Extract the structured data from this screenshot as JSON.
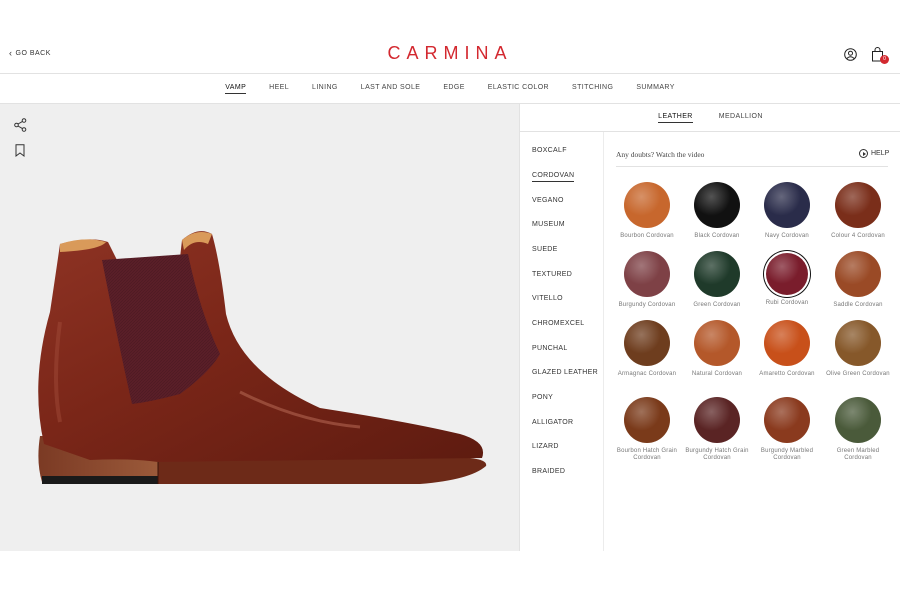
{
  "header": {
    "go_back": "GO BACK",
    "logo": "CARMINA",
    "cart_count": "0"
  },
  "nav": {
    "tabs": [
      "VAMP",
      "HEEL",
      "LINING",
      "LAST AND SOLE",
      "EDGE",
      "ELASTIC COLOR",
      "STITCHING",
      "SUMMARY"
    ],
    "active": "VAMP"
  },
  "panel": {
    "subtabs": [
      "LEATHER",
      "MEDALLION"
    ],
    "active_subtab": "LEATHER",
    "materials": [
      "BOXCALF",
      "CORDOVAN",
      "VEGANO",
      "MUSEUM",
      "SUEDE",
      "TEXTURED",
      "VITELLO",
      "CHROMEXCEL",
      "PUNCHAL",
      "GLAZED LEATHER",
      "PONY",
      "ALLIGATOR",
      "LIZARD",
      "BRAIDED"
    ],
    "active_material": "CORDOVAN",
    "doubts_text": "Any doubts? Watch the video",
    "help_label": "HELP",
    "swatches": [
      {
        "label": "Bourbon Cordovan",
        "color": "#c7672d"
      },
      {
        "label": "Black Cordovan",
        "color": "#111111"
      },
      {
        "label": "Navy Cordovan",
        "color": "#2a2c4a"
      },
      {
        "label": "Colour 4 Cordovan",
        "color": "#7a2e1a"
      },
      {
        "label": "Burgundy Cordovan",
        "color": "#7e4146"
      },
      {
        "label": "Green Cordovan",
        "color": "#1f3a2a"
      },
      {
        "label": "Rubi Cordovan",
        "color": "#7a1d2c"
      },
      {
        "label": "Saddle Cordovan",
        "color": "#9a4a26"
      },
      {
        "label": "Armagnac Cordovan",
        "color": "#6e3d1e"
      },
      {
        "label": "Natural Cordovan",
        "color": "#b4582a"
      },
      {
        "label": "Amaretto Cordovan",
        "color": "#c8501a"
      },
      {
        "label": "Olive Green Cordovan",
        "color": "#86582a"
      },
      {
        "label": "Bourbon Hatch Grain Cordovan",
        "color": "#7a3a1a"
      },
      {
        "label": "Burgundy Hatch Grain Cordovan",
        "color": "#5a2424"
      },
      {
        "label": "Burgundy Marbled Cordovan",
        "color": "#8a3a1e"
      },
      {
        "label": "Green Marbled Cordovan",
        "color": "#4a5a3a"
      }
    ],
    "selected_swatch": "Rubi Cordovan"
  },
  "colors": {
    "brand_red": "#d3282f",
    "boot_leather": "#7e2a1c",
    "boot_elastic": "#5a1f28"
  }
}
